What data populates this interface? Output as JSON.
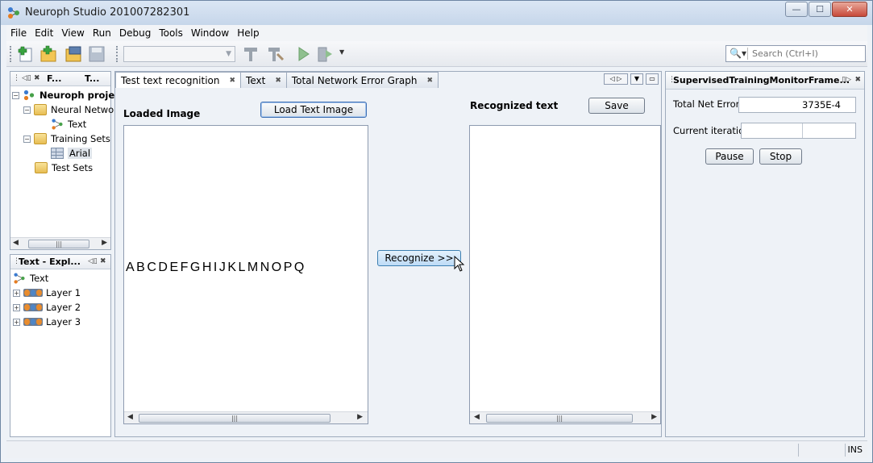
{
  "window": {
    "title": "Neuroph Studio 201007282301",
    "controls": {
      "minimize": "—",
      "maximize": "☐",
      "close": "✕"
    }
  },
  "menu": [
    "File",
    "Edit",
    "View",
    "Run",
    "Debug",
    "Tools",
    "Window",
    "Help"
  ],
  "toolbar": {
    "icons": [
      "new-project-icon",
      "new-file-icon",
      "open-project-icon",
      "save-icon",
      "build-icon",
      "clean-build-icon",
      "run-icon",
      "debug-icon"
    ],
    "config_combo_value": "",
    "search": {
      "placeholder": "Search (Ctrl+I)"
    }
  },
  "projects_panel": {
    "tabs": [
      "F...",
      "T..."
    ],
    "tree": [
      {
        "label": "Neuroph project",
        "bold": true
      },
      {
        "label": "Neural Networ"
      },
      {
        "label": "Text"
      },
      {
        "label": "Training Sets"
      },
      {
        "label": "Arial"
      },
      {
        "label": "Test Sets"
      }
    ]
  },
  "explorer_panel": {
    "title": "Text - Expl...",
    "root": "Text",
    "layers": [
      "Layer 1",
      "Layer 2",
      "Layer 3"
    ]
  },
  "editor": {
    "tabs": [
      {
        "label": "Test text recognition",
        "active": true
      },
      {
        "label": "Text",
        "active": false
      },
      {
        "label": "Total Network Error Graph",
        "active": false
      }
    ],
    "loaded_image_label": "Loaded Image",
    "load_button": "Load Text Image",
    "image_text": "ABCDEFGHIJKLMNOPQ",
    "recognize_button": "Recognize >>",
    "recognized_label": "Recognized text",
    "save_button": "Save",
    "recognized_value": ""
  },
  "monitor_panel": {
    "title": "SupervisedTrainingMonitorFrame...",
    "total_net_error_label": "Total Net Error",
    "total_net_error_value": "3735E-4",
    "current_iteration_label": "Current iteration",
    "current_iteration_value": "",
    "pause_button": "Pause",
    "stop_button": "Stop"
  },
  "statusbar": {
    "mode": "INS"
  }
}
